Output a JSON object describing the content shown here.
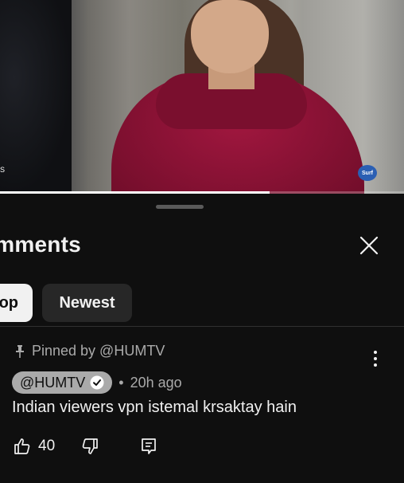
{
  "video": {
    "overlay_text": "S",
    "sponsor_logo_text": "Surf",
    "progress": 0.668
  },
  "comments_panel": {
    "title": "omments",
    "filters": [
      {
        "label": "op",
        "selected": true
      },
      {
        "label": "Newest",
        "selected": false
      }
    ]
  },
  "pinned_comment": {
    "pinned_label": "Pinned by @HUMTV",
    "author": "@HUMTV",
    "time_ago": "20h ago",
    "separator": "•",
    "text": "Indian viewers vpn istemal krsaktay hain",
    "like_count": "40"
  },
  "icons": {
    "close": "close-icon",
    "pin": "pin-icon",
    "verified": "verified-check-icon",
    "more": "more-vertical-icon",
    "like": "thumbs-up-icon",
    "dislike": "thumbs-down-icon",
    "reply": "reply-comment-icon"
  },
  "colors": {
    "background": "#0f0f0f",
    "text_primary": "#f1f1f1",
    "text_secondary": "#aaaaaa",
    "chip_selected": "#f1f1f1",
    "chip_default": "#272727"
  }
}
